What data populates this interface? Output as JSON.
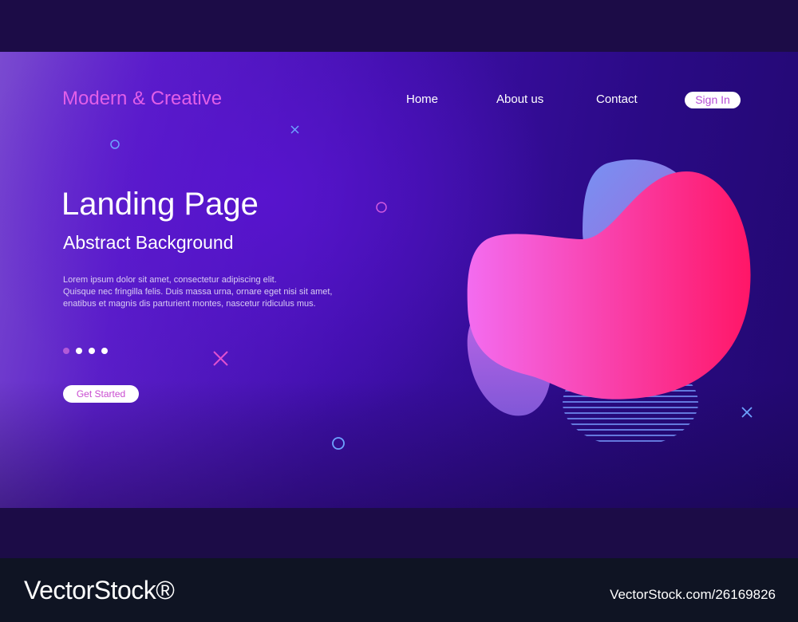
{
  "header": {
    "brand": "Modern & Creative",
    "nav": [
      "Home",
      "About us",
      "Contact"
    ],
    "sign_in": "Sign In"
  },
  "hero": {
    "title": "Landing Page",
    "subtitle": "Abstract Background",
    "body_lines": [
      "Lorem ipsum dolor sit amet, consectetur adipiscing elit.",
      "Quisque nec fringilla felis. Duis massa urna, ornare eget nisi sit amet,",
      "enatibus et magnis dis parturient montes, nascetur ridiculus mus."
    ],
    "slider": {
      "count": 4,
      "active_index": 1
    },
    "cta": "Get Started"
  },
  "footer": {
    "logo": "VectorStock®",
    "image_id": "VectorStock.com/26169826"
  },
  "colors": {
    "accent_pink": "#e25fe8",
    "blob_pink": "#ff1f7a",
    "background_purple": "#3e0fa8"
  }
}
